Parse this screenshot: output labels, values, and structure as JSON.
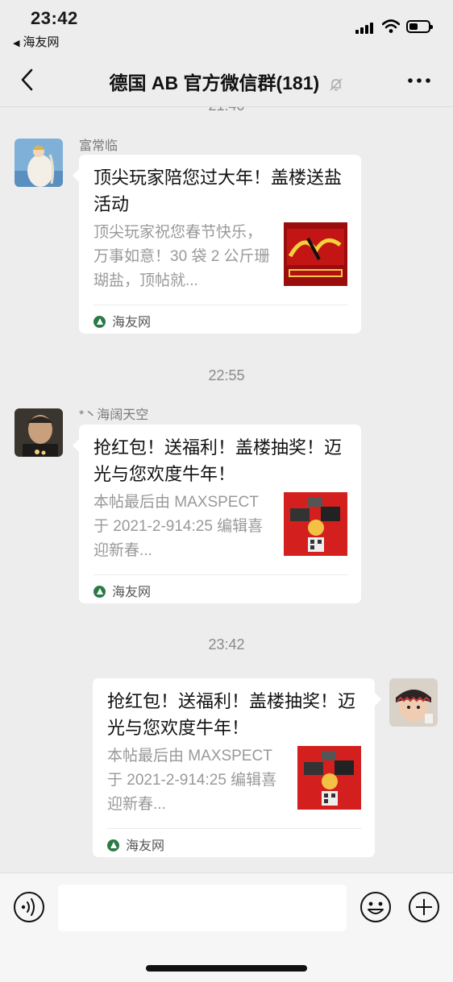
{
  "status_bar": {
    "time": "23:42",
    "back_app_label": "海友网"
  },
  "nav": {
    "title": "德国 AB  官方微信群(181)",
    "icons": {
      "back": "chevron-left-icon",
      "mute": "bell-off-icon",
      "more": "more-icon"
    }
  },
  "chat": {
    "partial_timestamp": "21:40",
    "messages": [
      {
        "sender": "富常临",
        "title": "顶尖玩家陪您过大年！盖楼送盐活动",
        "desc": "顶尖玩家祝您春节快乐，万事如意！30 袋 2 公斤珊瑚盐，顶帖就...",
        "source": "海友网"
      },
      {
        "timestamp": "22:55",
        "sender": "*丶海阔天空",
        "title": "抢红包！送福利！盖楼抽奖！迈光与您欢度牛年！",
        "desc": "本帖最后由 MAXSPECT 于 2021-2-914:25 编辑喜迎新春...",
        "source": "海友网"
      },
      {
        "timestamp": "23:42",
        "title": "抢红包！送福利！盖楼抽奖！迈光与您欢度牛年！",
        "desc": "本帖最后由 MAXSPECT 于 2021-2-914:25 编辑喜迎新春...",
        "source": "海友网"
      }
    ]
  },
  "input_bar": {
    "icons": {
      "voice": "voice-icon",
      "emoji": "emoji-icon",
      "plus": "plus-icon"
    }
  }
}
